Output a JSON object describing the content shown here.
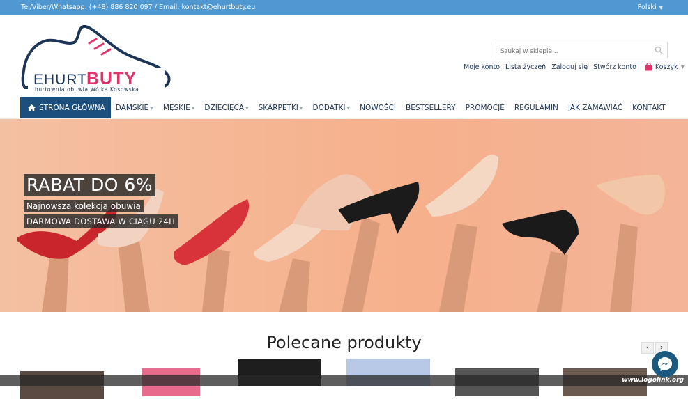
{
  "topbar": {
    "contact": "Tel/Viber/Whatsapp: (+48) 886 820 097 / Email: kontakt@ehurtbuty.eu",
    "language": "Polski"
  },
  "logo": {
    "brand_part1": "EHURT",
    "brand_part2": "BUTY",
    "tagline": "hurtownia obuwia Wólka Kosowska"
  },
  "search": {
    "placeholder": "Szukaj w sklepie..."
  },
  "account": {
    "my_account": "Moje konto",
    "wishlist": "Lista życzeń",
    "login": "Zaloguj się",
    "register": "Stwórz konto",
    "cart": "Koszyk"
  },
  "nav": {
    "items": [
      {
        "label": "STRONA GŁÓWNA"
      },
      {
        "label": "DAMSKIE"
      },
      {
        "label": "MĘSKIE"
      },
      {
        "label": "DZIECIĘCA"
      },
      {
        "label": "SKARPETKI"
      },
      {
        "label": "DODATKI"
      },
      {
        "label": "NOWOŚCI"
      },
      {
        "label": "BESTSELLERY"
      },
      {
        "label": "PROMOCJE"
      },
      {
        "label": "REGULAMIN"
      },
      {
        "label": "JAK ZAMAWIAĆ"
      },
      {
        "label": "KONTAKT"
      }
    ]
  },
  "banner": {
    "headline": "RABAT DO 6%",
    "line2": "Najnowsza kolekcja obuwia",
    "line3": "DARMOWA DOSTAWA W CIĄGU 24H"
  },
  "section": {
    "title": "Polecane produkty"
  },
  "carousel": {
    "prev": "‹",
    "next": "›"
  },
  "watermark": "www.logolink.org",
  "colors": {
    "topbar": "#4f98d2",
    "nav_active": "#1d4f7c",
    "brand_navy": "#1d3557",
    "brand_pink": "#e0356b"
  },
  "icons": {
    "home": "home-icon",
    "search": "search-icon",
    "cart": "shopping-bag-icon",
    "messenger": "messenger-icon"
  }
}
